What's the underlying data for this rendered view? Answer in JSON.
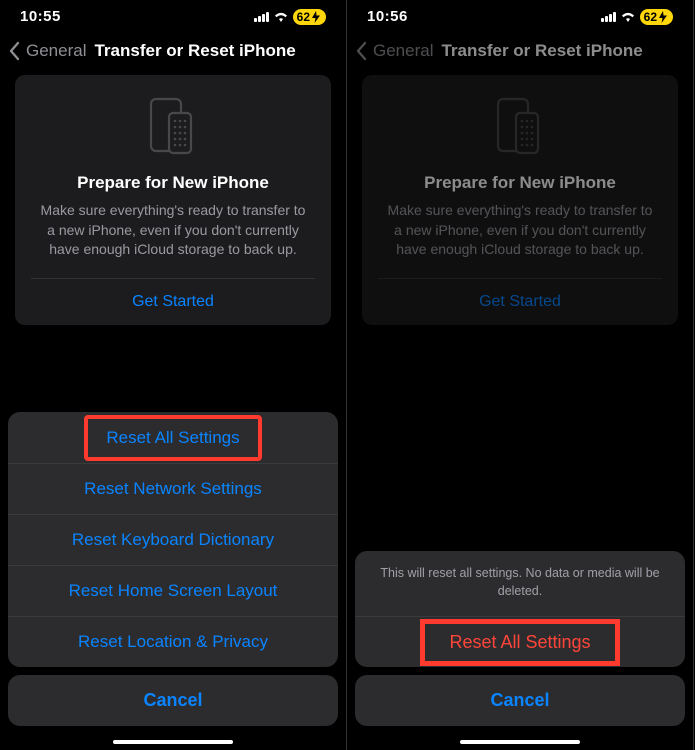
{
  "left": {
    "status": {
      "time": "10:55",
      "battery": "62"
    },
    "nav": {
      "back": "General",
      "title": "Transfer or Reset iPhone"
    },
    "card": {
      "title": "Prepare for New iPhone",
      "desc": "Make sure everything's ready to transfer to a new iPhone, even if you don't currently have enough iCloud storage to back up.",
      "cta": "Get Started"
    },
    "sheet": {
      "options": [
        "Reset All Settings",
        "Reset Network Settings",
        "Reset Keyboard Dictionary",
        "Reset Home Screen Layout",
        "Reset Location & Privacy"
      ],
      "cancel": "Cancel"
    }
  },
  "right": {
    "status": {
      "time": "10:56",
      "battery": "62"
    },
    "nav": {
      "back": "General",
      "title": "Transfer or Reset iPhone"
    },
    "card": {
      "title": "Prepare for New iPhone",
      "desc": "Make sure everything's ready to transfer to a new iPhone, even if you don't currently have enough iCloud storage to back up.",
      "cta": "Get Started"
    },
    "confirm": {
      "message": "This will reset all settings. No data or media will be deleted.",
      "action": "Reset All Settings",
      "cancel": "Cancel"
    }
  }
}
